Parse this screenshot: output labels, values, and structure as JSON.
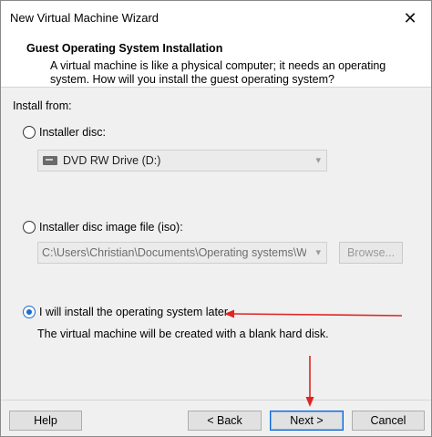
{
  "window": {
    "title": "New Virtual Machine Wizard",
    "close_glyph": "✕"
  },
  "header": {
    "title": "Guest Operating System Installation",
    "description": "A virtual machine is like a physical computer; it needs an operating system. How will you install the guest operating system?"
  },
  "install": {
    "label": "Install from:",
    "options": [
      {
        "label": "Installer disc:",
        "selected": false
      },
      {
        "label": "Installer disc image file (iso):",
        "selected": false
      },
      {
        "label": "I will install the operating system later",
        "selected": true
      }
    ],
    "disc_drive": "DVD RW Drive (D:)",
    "iso_path": "C:\\Users\\Christian\\Documents\\Operating systems\\Win",
    "browse_label": "Browse...",
    "later_note": "The virtual machine will be created with a blank hard disk."
  },
  "footer": {
    "help": "Help",
    "back": "< Back",
    "next": "Next >",
    "cancel": "Cancel"
  },
  "colors": {
    "accent": "#1a6fd1",
    "annotation_arrow": "#e02424",
    "primary_button_border": "#0a64d6"
  },
  "icons": [
    "close-icon",
    "drive-icon",
    "chevron-down-icon"
  ]
}
